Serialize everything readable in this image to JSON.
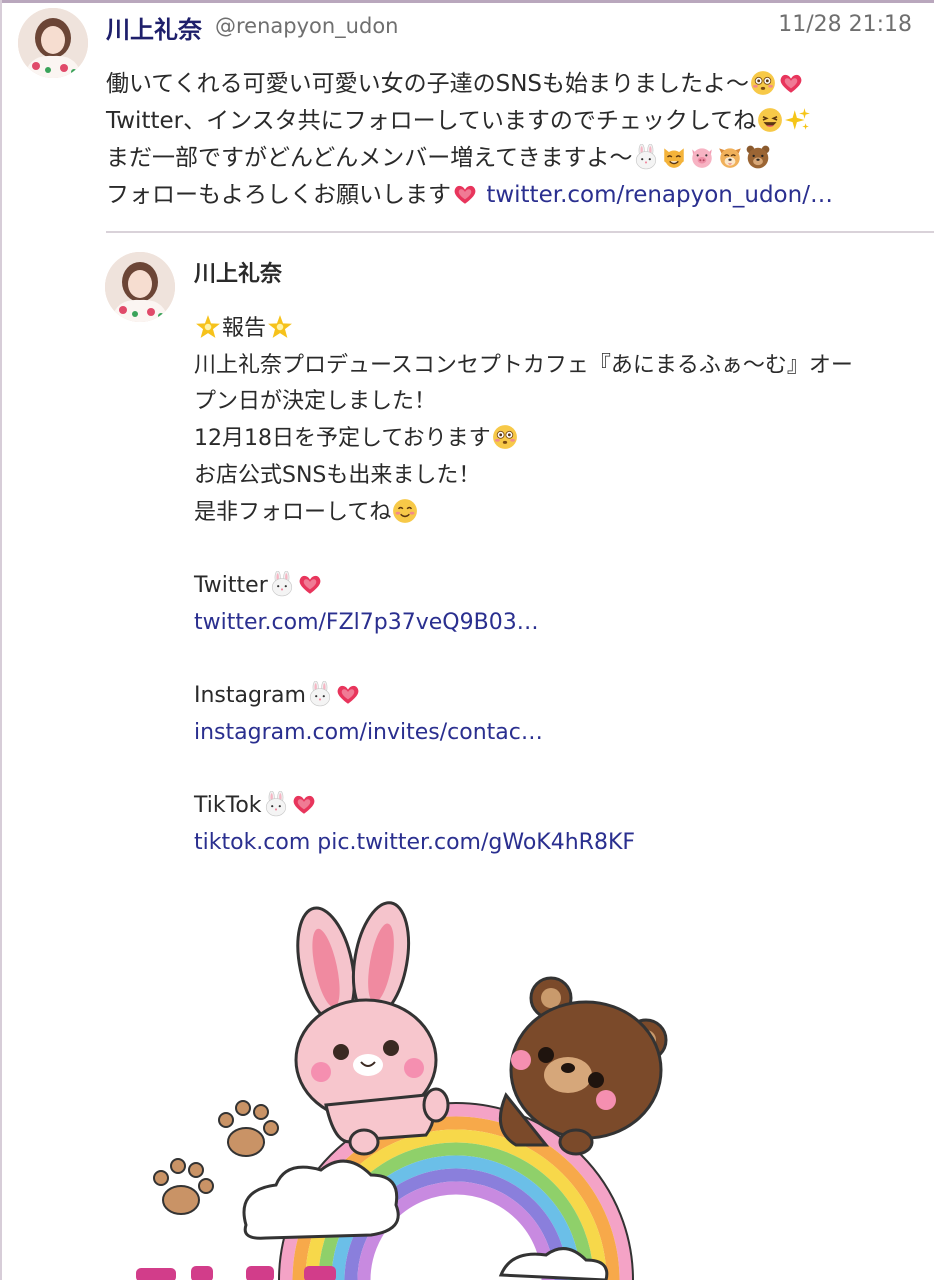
{
  "post": {
    "author_name": "川上礼奈",
    "handle": "@renapyon_udon",
    "timestamp": "11/28 21:18",
    "lines": [
      "働いてくれる可愛い可愛い女の子達のSNSも始まりましたよ〜",
      "Twitter、インスタ共にフォローしていますのでチェックしてね",
      "まだ一部ですがどんどんメンバー増えてきますよ〜",
      "フォローもよろしくお願いします"
    ],
    "link": "twitter.com/renapyon_udon/…"
  },
  "quoted": {
    "author_name": "川上礼奈",
    "report": "報告",
    "lines": [
      "川上礼奈プロデュースコンセプトカフェ『あにまるふぁ〜む』オー",
      "プン日が決定しました！",
      "12月18日を予定しております",
      "お店公式SNSも出来ました！",
      "是非フォローしてね"
    ],
    "twitter_label": "Twitter",
    "twitter_link": "twitter.com/FZl7p37veQ9B03…",
    "instagram_label": "Instagram",
    "instagram_link": "instagram.com/invites/contac…",
    "tiktok_label": "TikTok",
    "tiktok_link": "tiktok.com",
    "pic_link": "pic.twitter.com/gWoK4hR8KF"
  },
  "icons": {
    "flushed": "flushed-face-icon",
    "heart": "heart-icon",
    "laugh": "laughing-face-icon",
    "sparkles": "sparkles-icon",
    "rabbit": "rabbit-face-icon",
    "cat": "cat-face-icon",
    "pig": "pig-face-icon",
    "dog": "dog-face-icon",
    "bear": "bear-face-icon",
    "star": "star-icon",
    "smile": "smiling-face-icon"
  },
  "colors": {
    "name": "#1e1f6b",
    "link": "#2a2f8f",
    "meta": "#6f6f6f"
  }
}
